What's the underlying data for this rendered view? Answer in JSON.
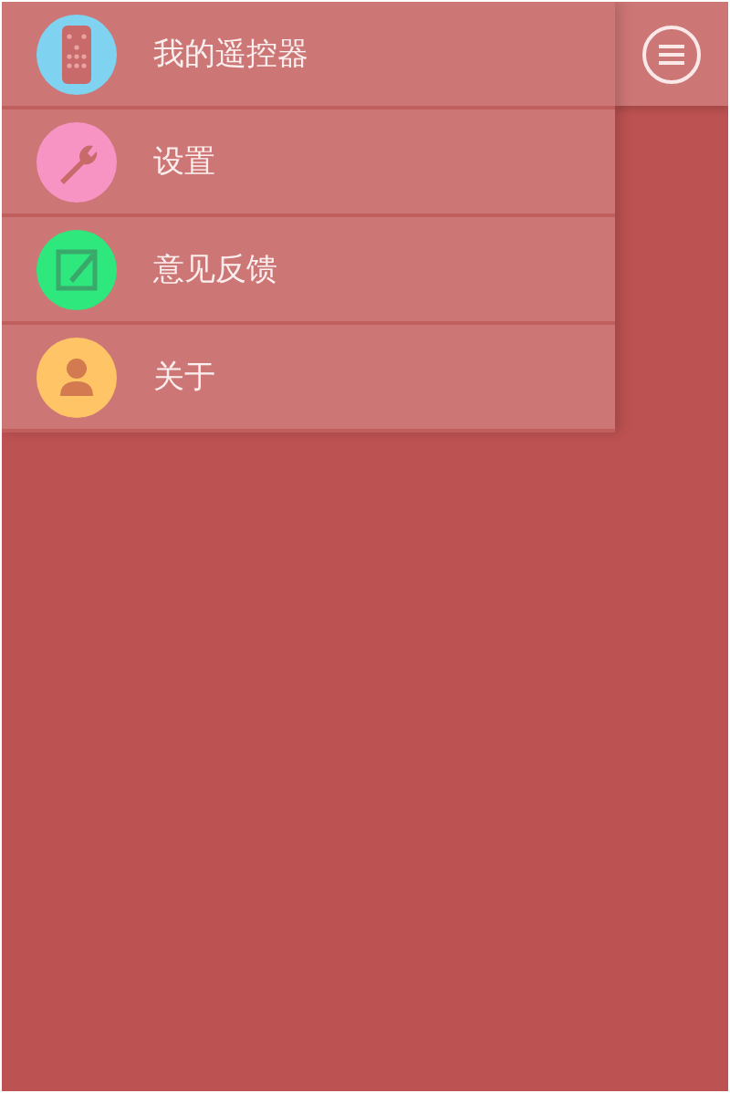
{
  "menu": [
    {
      "label": "我的遥控器",
      "kind": "remote",
      "color": "#7fd3f0"
    },
    {
      "label": "设置",
      "kind": "wrench",
      "color": "#f794c4"
    },
    {
      "label": "意见反馈",
      "kind": "edit",
      "color": "#2ee87e"
    },
    {
      "label": "关于",
      "kind": "person",
      "color": "#ffc466"
    }
  ]
}
